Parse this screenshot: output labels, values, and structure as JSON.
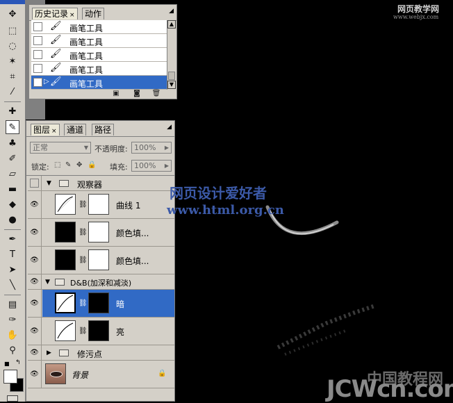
{
  "toolbox": {
    "tools": [
      "move-icon",
      "marquee-icon",
      "lasso-icon",
      "magic-wand-icon",
      "crop-icon",
      "slice-icon",
      "healing-icon",
      "brush-icon",
      "stamp-icon",
      "history-brush-icon",
      "eraser-icon",
      "gradient-icon",
      "blur-icon",
      "dodge-icon",
      "pen-icon",
      "type-icon",
      "path-select-icon",
      "line-icon",
      "notes-icon",
      "eyedropper-icon",
      "hand-icon",
      "zoom-icon"
    ]
  },
  "history": {
    "tabs": [
      {
        "label": "历史记录"
      },
      {
        "label": "动作"
      }
    ],
    "close": "×",
    "items": [
      {
        "label": "画笔工具"
      },
      {
        "label": "画笔工具"
      },
      {
        "label": "画笔工具"
      },
      {
        "label": "画笔工具"
      },
      {
        "label": "画笔工具"
      }
    ]
  },
  "layers": {
    "tabs": [
      {
        "label": "图层"
      },
      {
        "label": "通道"
      },
      {
        "label": "路径"
      }
    ],
    "close": "×",
    "blend_mode": "正常",
    "opacity_label": "不透明度:",
    "opacity_value": "100%",
    "lock_label": "锁定:",
    "fill_label": "填充:",
    "fill_value": "100%",
    "rows": [
      {
        "name": "观察器"
      },
      {
        "name": "曲线 1"
      },
      {
        "name": "颜色填..."
      },
      {
        "name": "颜色填..."
      },
      {
        "name": "D&B(加深和减淡)"
      },
      {
        "name": "暗"
      },
      {
        "name": "亮"
      },
      {
        "name": "修污点"
      },
      {
        "name": "背景"
      }
    ]
  },
  "watermarks": {
    "top_right": "网页教学网",
    "top_right_url": "www.webjx.com",
    "center_cn": "网页设计爱好者",
    "center_url": "www.html.org.cn",
    "bottom_cn": "中国教程网",
    "bottom_url": "JCWcn.com"
  },
  "colors": {
    "panel_bg": "#d4d0c8",
    "selection": "#316ac5",
    "canvas": "#000000"
  }
}
